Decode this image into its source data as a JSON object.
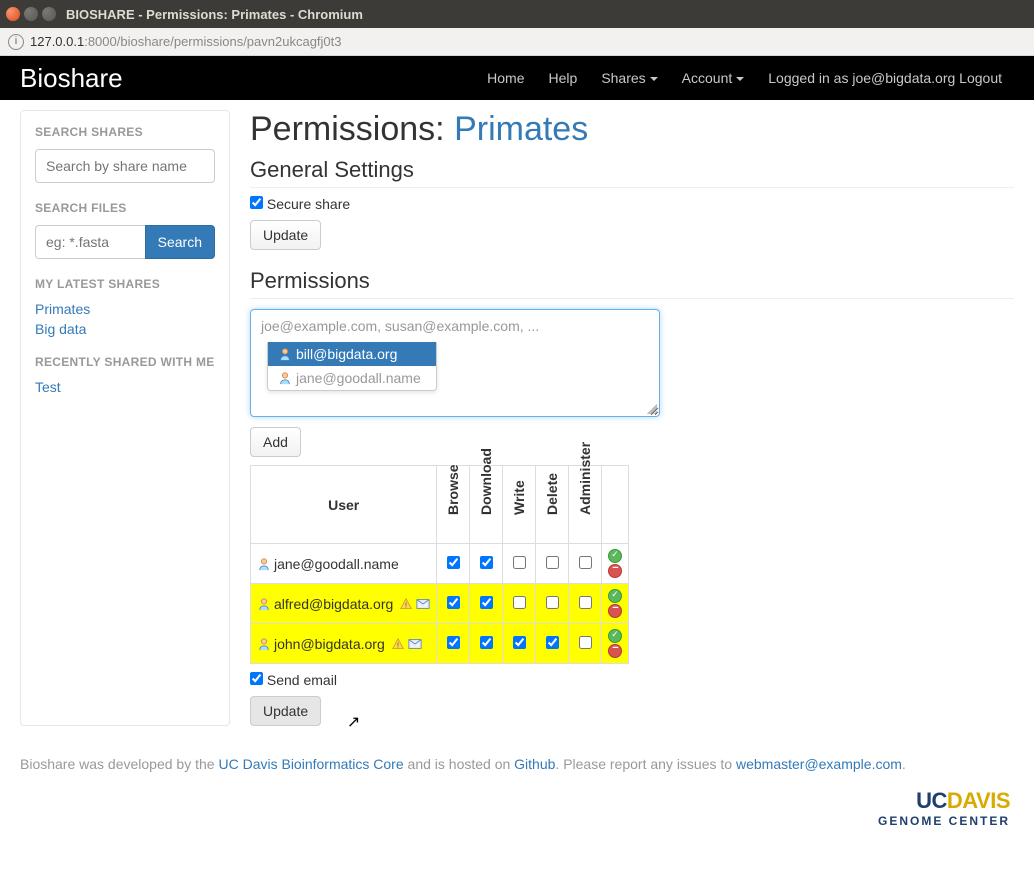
{
  "window": {
    "title": "BIOSHARE - Permissions: Primates - Chromium"
  },
  "url": {
    "host": "127.0.0.1",
    "path": ":8000/bioshare/permissions/pavn2ukcagfj0t3"
  },
  "brand": "Bioshare",
  "nav": {
    "home": "Home",
    "help": "Help",
    "shares": "Shares",
    "account": "Account",
    "logged_in": "Logged in as joe@bigdata.org Logout"
  },
  "sidebar": {
    "search_shares_h": "SEARCH SHARES",
    "search_shares_ph": "Search by share name",
    "search_files_h": "SEARCH FILES",
    "search_files_ph": "eg: *.fasta",
    "search_btn": "Search",
    "latest_h": "MY LATEST SHARES",
    "latest": [
      "Primates",
      "Big data"
    ],
    "recent_h": "RECENTLY SHARED WITH ME",
    "recent": [
      "Test"
    ]
  },
  "page": {
    "title_prefix": "Permissions: ",
    "share_name": "Primates",
    "general_h": "General Settings",
    "secure_label": "Secure share",
    "update_btn": "Update",
    "permissions_h": "Permissions",
    "email_ph": "joe@example.com, susan@example.com, ...",
    "suggestions": [
      {
        "email": "bill@bigdata.org",
        "active": true
      },
      {
        "email": "jane@goodall.name",
        "active": false
      }
    ],
    "add_btn": "Add",
    "cols": {
      "user": "User",
      "browse": "Browse",
      "download": "Download",
      "write": "Write",
      "delete": "Delete",
      "administer": "Administer"
    },
    "rows": [
      {
        "user": "jane@goodall.name",
        "browse": true,
        "download": true,
        "write": false,
        "delete": false,
        "administer": false,
        "new": false
      },
      {
        "user": "alfred@bigdata.org",
        "browse": true,
        "download": true,
        "write": false,
        "delete": false,
        "administer": false,
        "new": true
      },
      {
        "user": "john@bigdata.org",
        "browse": true,
        "download": true,
        "write": true,
        "delete": true,
        "administer": false,
        "new": true
      }
    ],
    "send_email_label": "Send email",
    "update2_btn": "Update"
  },
  "footer": {
    "t1": "Bioshare was developed by the ",
    "l1": "UC Davis Bioinformatics Core",
    "t2": " and is hosted on ",
    "l2": "Github",
    "t3": ". Please report any issues to ",
    "l3": "webmaster@example.com",
    "t4": "."
  },
  "logo": {
    "uc": "UC",
    "davis": "DAVIS",
    "sub": "GENOME CENTER"
  }
}
